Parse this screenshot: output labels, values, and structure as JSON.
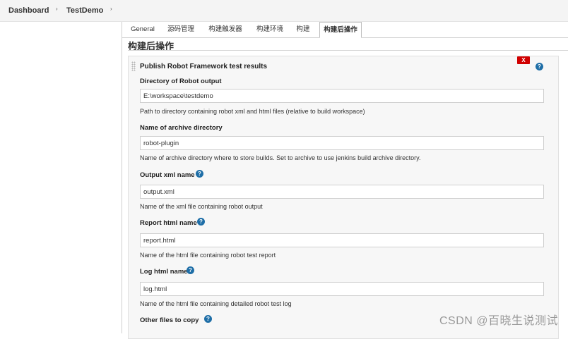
{
  "breadcrumb": {
    "items": [
      "Dashboard",
      "TestDemo"
    ],
    "separator": "›"
  },
  "tabs": [
    {
      "label": "General",
      "active": false
    },
    {
      "label": "源码管理",
      "active": false
    },
    {
      "label": "构建触发器",
      "active": false
    },
    {
      "label": "构建环境",
      "active": false
    },
    {
      "label": "构建",
      "active": false
    },
    {
      "label": "构建后操作",
      "active": true
    }
  ],
  "section": {
    "title": "构建后操作"
  },
  "publisher": {
    "title": "Publish Robot Framework test results",
    "delete_label": "X",
    "help_label": "?",
    "fields": [
      {
        "label": "Directory of Robot output",
        "value": "E:\\workspace\\testdemo",
        "description": "Path to directory containing robot xml and html files (relative to build workspace)",
        "has_help": false
      },
      {
        "label": "Name of archive directory",
        "value": "robot-plugin",
        "description": "Name of archive directory where to store builds. Set to archive to use jenkins build archive directory.",
        "has_help": false
      },
      {
        "label": "Output xml name",
        "value": "output.xml",
        "description": "Name of the xml file containing robot output",
        "has_help": true
      },
      {
        "label": "Report html name",
        "value": "report.html",
        "description": "Name of the html file containing robot test report",
        "has_help": true
      },
      {
        "label": "Log html name",
        "value": "log.html",
        "description": "Name of the html file containing detailed robot test log",
        "has_help": true
      },
      {
        "label": "Other files to copy",
        "has_help": true
      }
    ]
  },
  "watermark": "CSDN @百晓生说测试",
  "colors": {
    "help_icon": "#1e6ea7",
    "delete_button": "#d10000",
    "panel_bg": "#f7f7f7"
  }
}
